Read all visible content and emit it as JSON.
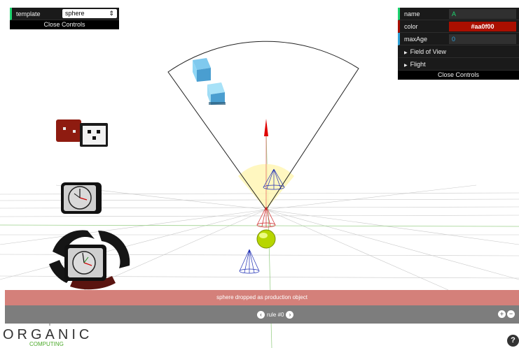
{
  "left_panel": {
    "template_label": "template",
    "template_value": "sphere",
    "close_label": "Close Controls"
  },
  "right_panel": {
    "name_label": "name",
    "name_value": "A",
    "color_label": "color",
    "color_value": "#aa0f00",
    "maxage_label": "maxAge",
    "maxage_value": "0",
    "folder_fov": "Field of View",
    "folder_flight": "Flight",
    "close_label": "Close Controls"
  },
  "status": {
    "message": "sphere dropped as production object"
  },
  "rule_bar": {
    "rule_label": "rule #0",
    "zoom_in": "+",
    "zoom_out": "−"
  },
  "logo": {
    "title": "ORGANIC",
    "subtitle": "COMPUTING"
  },
  "help": {
    "label": "?"
  },
  "colors": {
    "accent_green": "#1ed36f",
    "agent_color": "#aa0f00",
    "number_blue": "#2fa1d6",
    "status_red": "#d4807a"
  },
  "icons": [
    "sheep-icon-usb",
    "clock-icon",
    "recycle-clock-icon",
    "cube-icon",
    "cone-icon",
    "sphere-icon",
    "prev-arrow-icon",
    "next-arrow-icon",
    "zoom-in-icon",
    "zoom-out-icon",
    "help-icon",
    "leaf-logo-icon"
  ]
}
